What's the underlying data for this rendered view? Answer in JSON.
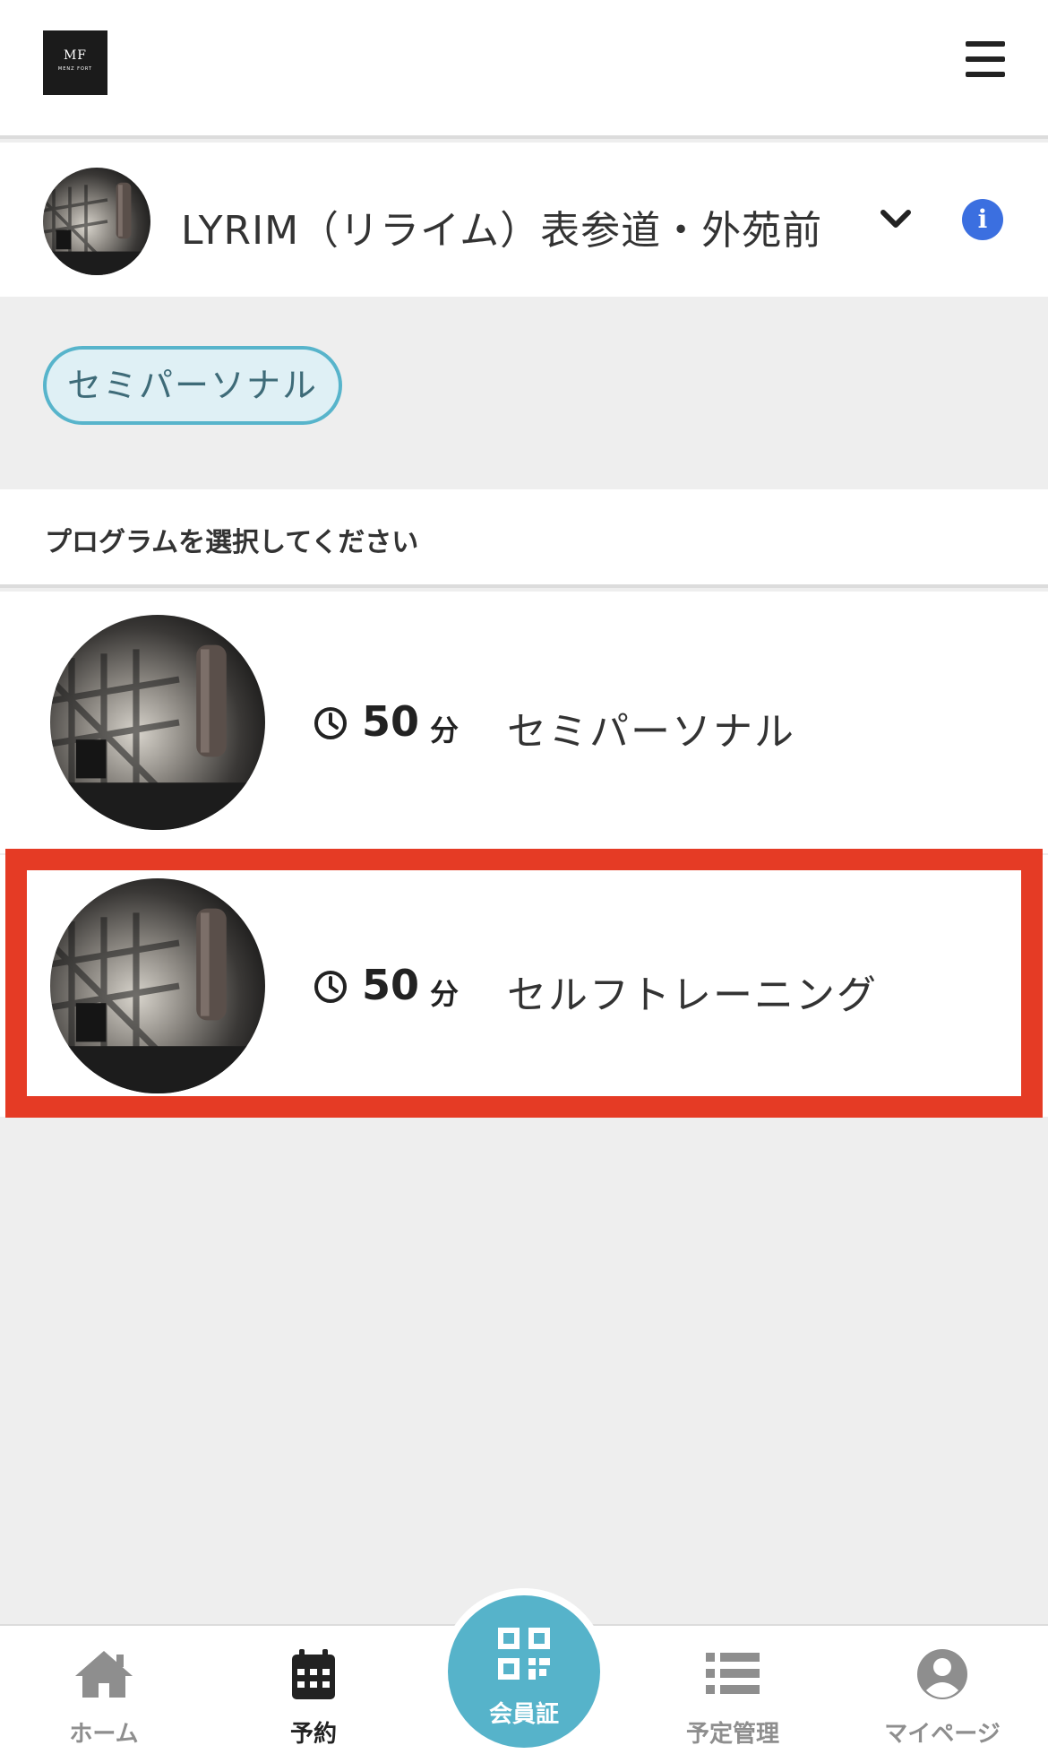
{
  "header": {
    "logo_mark": "MF",
    "logo_sub": "MENZ FORT"
  },
  "studio": {
    "name": "LYRIM（リライム）表参道・外苑前"
  },
  "category": {
    "chip_label": "セミパーソナル"
  },
  "instruction": "プログラムを選択してください",
  "programs": [
    {
      "duration": "50",
      "unit": "分",
      "name": "セミパーソナル"
    },
    {
      "duration": "50",
      "unit": "分",
      "name": "セルフトレーニング"
    }
  ],
  "nav": {
    "home": "ホーム",
    "reserve": "予約",
    "member_card": "会員証",
    "schedule": "予定管理",
    "mypage": "マイページ"
  },
  "colors": {
    "accent": "#56b3ca",
    "highlight": "#e53b25",
    "info": "#3b6fe0"
  }
}
